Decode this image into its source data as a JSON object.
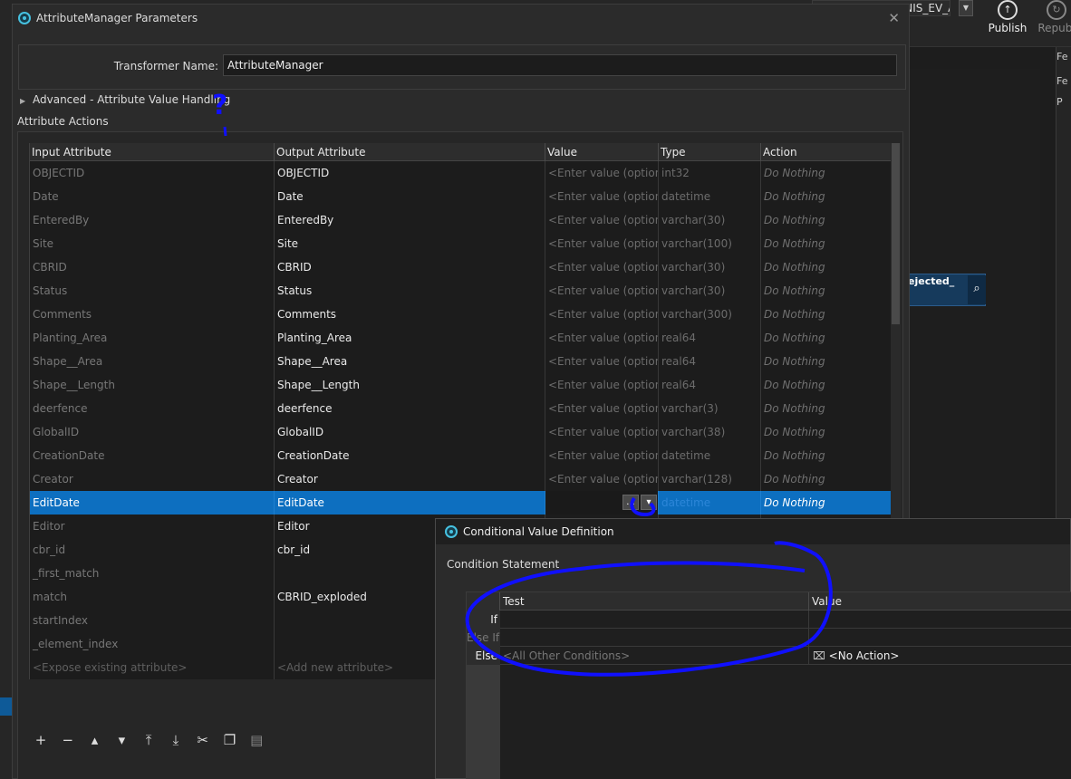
{
  "background": {
    "flow_label": "RV_...DYIS_FLAUNIS_EV_AVE Flow",
    "publish_label": "Publish",
    "republish_label": "Republ",
    "node_label": "ejected_",
    "right_tab_label": "Fe",
    "right_tab_label2": "Fe",
    "right_tab_label3": "P"
  },
  "dialog": {
    "title": "AttributeManager Parameters",
    "close_label": "✕",
    "transformer_name_label": "Transformer Name:",
    "transformer_name_value": "AttributeManager",
    "advanced_label": "Advanced - Attribute Value Handling",
    "actions_label": "Attribute Actions"
  },
  "grid": {
    "headers": [
      "Input Attribute",
      "Output Attribute",
      "Value",
      "Type",
      "Action"
    ],
    "value_placeholder": "<Enter value (optional)>",
    "rows": [
      {
        "input": "OBJECTID",
        "output": "OBJECTID",
        "value": "<Enter value (optional)>",
        "type": "int32",
        "action": "Do Nothing"
      },
      {
        "input": "Date",
        "output": "Date",
        "value": "<Enter value (optional)>",
        "type": "datetime",
        "action": "Do Nothing"
      },
      {
        "input": "EnteredBy",
        "output": "EnteredBy",
        "value": "<Enter value (optional)>",
        "type": "varchar(30)",
        "action": "Do Nothing"
      },
      {
        "input": "Site",
        "output": "Site",
        "value": "<Enter value (optional)>",
        "type": "varchar(100)",
        "action": "Do Nothing"
      },
      {
        "input": "CBRID",
        "output": "CBRID",
        "value": "<Enter value (optional)>",
        "type": "varchar(30)",
        "action": "Do Nothing"
      },
      {
        "input": "Status",
        "output": "Status",
        "value": "<Enter value (optional)>",
        "type": "varchar(30)",
        "action": "Do Nothing"
      },
      {
        "input": "Comments",
        "output": "Comments",
        "value": "<Enter value (optional)>",
        "type": "varchar(300)",
        "action": "Do Nothing"
      },
      {
        "input": "Planting_Area",
        "output": "Planting_Area",
        "value": "<Enter value (optional)>",
        "type": "real64",
        "action": "Do Nothing"
      },
      {
        "input": "Shape__Area",
        "output": "Shape__Area",
        "value": "<Enter value (optional)>",
        "type": "real64",
        "action": "Do Nothing"
      },
      {
        "input": "Shape__Length",
        "output": "Shape__Length",
        "value": "<Enter value (optional)>",
        "type": "real64",
        "action": "Do Nothing"
      },
      {
        "input": "deerfence",
        "output": "deerfence",
        "value": "<Enter value (optional)>",
        "type": "varchar(3)",
        "action": "Do Nothing"
      },
      {
        "input": "GlobalID",
        "output": "GlobalID",
        "value": "<Enter value (optional)>",
        "type": "varchar(38)",
        "action": "Do Nothing"
      },
      {
        "input": "CreationDate",
        "output": "CreationDate",
        "value": "<Enter value (optional)>",
        "type": "datetime",
        "action": "Do Nothing"
      },
      {
        "input": "Creator",
        "output": "Creator",
        "value": "<Enter value (optional)>",
        "type": "varchar(128)",
        "action": "Do Nothing"
      },
      {
        "input": "EditDate",
        "output": "EditDate",
        "value": "",
        "type": "datetime",
        "action": "Do Nothing",
        "selected": true
      },
      {
        "input": "Editor",
        "output": "Editor",
        "value": "",
        "type": "",
        "action": ""
      },
      {
        "input": "cbr_id",
        "output": "cbr_id",
        "value": "",
        "type": "",
        "action": ""
      },
      {
        "input": "_first_match",
        "output": "",
        "value": "",
        "type": "",
        "action": ""
      },
      {
        "input": "match",
        "output": "CBRID_exploded",
        "value": "",
        "type": "",
        "action": ""
      },
      {
        "input": "startIndex",
        "output": "",
        "value": "",
        "type": "",
        "action": ""
      },
      {
        "input": "_element_index",
        "output": "",
        "value": "",
        "type": "",
        "action": ""
      }
    ],
    "footer_input": "<Expose existing attribute>",
    "footer_output": "<Add new attribute>",
    "ellipsis_label": "...",
    "dropdown_label": "▾"
  },
  "conditional": {
    "title": "Conditional Value Definition",
    "condition_label": "Condition Statement",
    "headers": [
      "Test",
      "Value"
    ],
    "rows": [
      {
        "key": "If",
        "test": "",
        "value": ""
      },
      {
        "key": "Else If",
        "test": "",
        "value": ""
      },
      {
        "key": "Else",
        "test": "<All Other Conditions>",
        "value": "<No Action>"
      }
    ]
  },
  "annotation": {
    "question_mark": "?"
  },
  "colors": {
    "selection": "#0d6fc0",
    "annotation": "#1010ff",
    "accent": "#46c1e0"
  }
}
